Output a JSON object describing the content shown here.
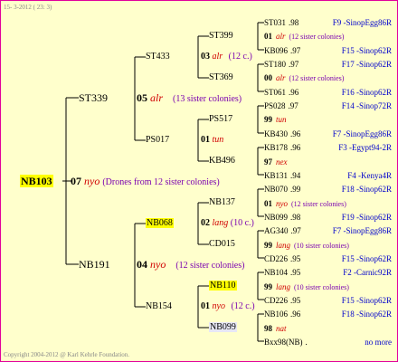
{
  "header": {
    "date": "15- 3-2012 ( 23: 3)"
  },
  "footer": {
    "copyright": "Copyright 2004-2012 @ Karl Kehrle Foundation."
  },
  "queen": {
    "name": "NB103",
    "year": "07",
    "race": "nyo",
    "note": "(Drones from 12 sister colonies)"
  },
  "gen1": {
    "st339": {
      "name": "ST339",
      "year": "05",
      "race": "alr",
      "note": "(13 sister colonies)"
    },
    "nb191": {
      "name": "NB191",
      "year": "04",
      "race": "nyo",
      "note": "(12 sister colonies)"
    }
  },
  "gen2": {
    "st433": {
      "name": "ST433",
      "year": "03",
      "race": "alr",
      "note": "(12 c.)"
    },
    "ps017": {
      "name": "PS017",
      "year": "01",
      "race": "tun"
    },
    "nb068": {
      "name": "NB068",
      "year": "02",
      "race": "lang",
      "note": "(10 c.)"
    },
    "nb154": {
      "name": "NB154",
      "year": "01",
      "race": "nyo",
      "note": "(12 c.)"
    }
  },
  "gen3": {
    "st399": {
      "name": "ST399"
    },
    "st369": {
      "name": "ST369"
    },
    "ps517": {
      "name": "PS517"
    },
    "kb496": {
      "name": "KB496"
    },
    "nb137": {
      "name": "NB137"
    },
    "cd015": {
      "name": "CD015"
    },
    "nb110": {
      "name": "NB110"
    },
    "nb099": {
      "name": "NB099"
    }
  },
  "gen4": [
    {
      "name": "ST031",
      "year": ".98",
      "ref": "F9 -SinopEgg86R"
    },
    {
      "year": "01",
      "race": "alr",
      "note": "(12 sister colonies)"
    },
    {
      "name": "KB096",
      "year": ".97",
      "ref": "F15 -Sinop62R"
    },
    {
      "name": "ST180",
      "year": ".97",
      "ref": "F17 -Sinop62R"
    },
    {
      "year": "00",
      "race": "alr",
      "note": "(12 sister colonies)"
    },
    {
      "name": "ST061",
      "year": ".96",
      "ref": "F16 -Sinop62R"
    },
    {
      "name": "PS028",
      "year": ".97",
      "ref": "F14 -Sinop72R"
    },
    {
      "year": "99",
      "race": "tun"
    },
    {
      "name": "KB430",
      "year": ".96",
      "ref": "F7 -SinopEgg86R"
    },
    {
      "name": "KB178",
      "year": ".96",
      "ref": "F3 -Egypt94-2R"
    },
    {
      "year": "97",
      "race": "nex"
    },
    {
      "name": "KB131",
      "year": ".94",
      "ref": "F4 -Kenya4R"
    },
    {
      "name": "NB070",
      "year": ".99",
      "ref": "F18 -Sinop62R"
    },
    {
      "year": "01",
      "race": "nyo",
      "note": "(12 sister colonies)"
    },
    {
      "name": "NB099",
      "year": ".98",
      "ref": "F19 -Sinop62R"
    },
    {
      "name": "AG340",
      "year": ".97",
      "ref": "F7 -SinopEgg86R"
    },
    {
      "year": "99",
      "race": "lang",
      "note": "(10 sister colonies)"
    },
    {
      "name": "CD226",
      "year": ".95",
      "ref": "F15 -Sinop62R"
    },
    {
      "name": "NB104",
      "year": ".95",
      "ref": "F2 -Carnic92R"
    },
    {
      "year": "99",
      "race": "lang",
      "note": "(10 sister colonies)"
    },
    {
      "name": "CD226",
      "year": ".95",
      "ref": "F15 -Sinop62R"
    },
    {
      "name": "NB106",
      "year": ".96",
      "ref": "F18 -Sinop62R"
    },
    {
      "year": "98",
      "race": "nat"
    },
    {
      "name": "Bxx98(NB)",
      "year": ".",
      "ref": "no more"
    }
  ],
  "colors": {
    "border": "#e1009b",
    "background": "#ffffcc",
    "highlight": "#ffff00",
    "race": "#d00000",
    "reference": "#0000cc"
  }
}
